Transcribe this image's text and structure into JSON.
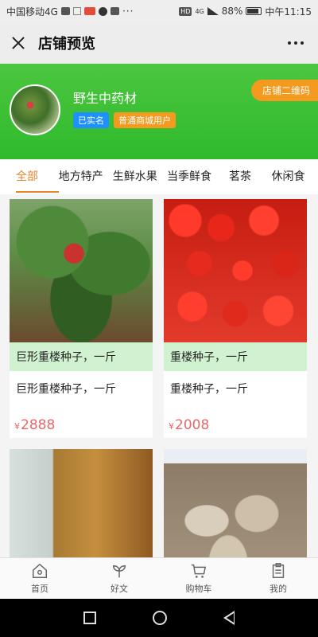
{
  "status_bar": {
    "carrier": "中国移动4G",
    "network_badge": "HD",
    "signal_label": "4G",
    "battery": "88%",
    "time": "中午11:15"
  },
  "titlebar": {
    "title": "店铺预览"
  },
  "shop": {
    "name": "野生中药材",
    "badge_verified": "已实名",
    "badge_user_type": "普通商城用户",
    "qr_button": "店铺二维码"
  },
  "tabs": [
    {
      "label": "全部",
      "active": true
    },
    {
      "label": "地方特产"
    },
    {
      "label": "生鲜水果"
    },
    {
      "label": "当季鲜食"
    },
    {
      "label": "茗茶"
    },
    {
      "label": "休闲食"
    }
  ],
  "products": [
    {
      "overlay": "巨形重楼种子，一斤",
      "name": "巨形重楼种子，一斤",
      "currency": "¥",
      "price": "2888"
    },
    {
      "overlay": "重楼种子，一斤",
      "name": "重楼种子，一斤",
      "currency": "¥",
      "price": "2008"
    },
    {
      "overlay": "",
      "name": "",
      "currency": "",
      "price": ""
    },
    {
      "overlay": "",
      "name": "",
      "currency": "",
      "price": ""
    }
  ],
  "bottom_nav": [
    {
      "label": "首页",
      "icon": "home-icon"
    },
    {
      "label": "好文",
      "icon": "sprout-icon"
    },
    {
      "label": "购物车",
      "icon": "cart-icon"
    },
    {
      "label": "我的",
      "icon": "clipboard-icon"
    }
  ],
  "colors": {
    "header_green": "#35bd2f",
    "accent_orange": "#e8852b",
    "price_red": "#e8686a",
    "badge_blue": "#1e90ff"
  }
}
